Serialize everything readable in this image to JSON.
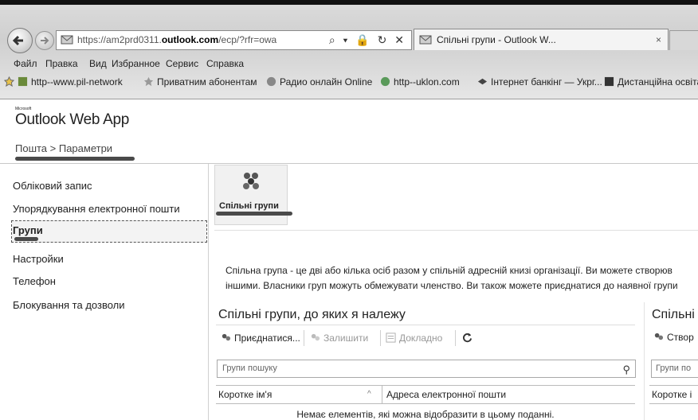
{
  "browser": {
    "url_prefix": "https://am2prd0311.",
    "url_domain": "outlook.com",
    "url_suffix": "/ecp/?rfr=owa",
    "address_tools": "⌕ ▾ 🔒 ↻ ✕",
    "tab_title": "Спільні групи - Outlook W...",
    "tab_close": "×",
    "menu": [
      "Файл",
      "Правка",
      "Вид",
      "Избранное",
      "Сервис",
      "Справка"
    ],
    "favorites": [
      "http--www.pil-network",
      "Приватним абонентам",
      "Радио онлайн Online",
      "http--uklon.com",
      "Інтернет банкінг — Укрг...",
      "Дистанційна освіта"
    ]
  },
  "app": {
    "logo": "Outlook Web App",
    "logo_small": "Microsoft",
    "breadcrumb": "Пошта > Параметри"
  },
  "nav": {
    "items": [
      "Обліковий запис",
      "Упорядкування електронної пошти",
      "Групи",
      "Настройки",
      "Телефон",
      "Блокування та дозволи"
    ],
    "selected_index": 2
  },
  "tile": {
    "label": "Спільні групи"
  },
  "description": {
    "line1": "Спільна група - це дві або кілька осіб разом у спільній адресній книзі організації. Ви можете створюв",
    "line2": "іншими. Власники груп можуть обмежувати членство. Ви також можете приєднатися до наявної групи"
  },
  "left_panel": {
    "title": "Спільні групи, до яких я належу",
    "toolbar": {
      "join": "Приєднатися...",
      "leave": "Залишити",
      "details": "Докладно"
    },
    "search_placeholder": "Групи пошуку",
    "columns": {
      "short_name": "Коротке ім'я",
      "email": "Адреса електронної пошти"
    },
    "empty_message": "Немає елементів, які можна відобразити в цьому поданні."
  },
  "right_panel": {
    "title": "Спільні",
    "toolbar_create": "Створ",
    "search_placeholder": "Групи по",
    "column": "Коротке і"
  },
  "colors": {
    "mark": "#4a4a4a",
    "chrome": "#d6d6d6"
  }
}
